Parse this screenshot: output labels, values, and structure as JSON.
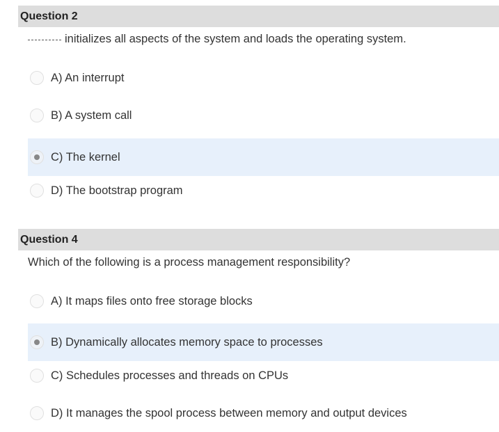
{
  "questions": [
    {
      "title": "Question 2",
      "blank": "______",
      "prompt": "initializes all aspects of the system and loads the operating system.",
      "options": [
        {
          "label": "A) An interrupt",
          "selected": false
        },
        {
          "label": "B) A system call",
          "selected": false
        },
        {
          "label": "C) The kernel",
          "selected": true
        },
        {
          "label": "D) The bootstrap program",
          "selected": false
        }
      ]
    },
    {
      "title": "Question 4",
      "prompt": "Which of the following is a process management responsibility?",
      "options": [
        {
          "label": "A) It maps files onto free storage blocks",
          "selected": false
        },
        {
          "label": "B) Dynamically allocates memory space to processes",
          "selected": true
        },
        {
          "label": "C) Schedules processes and threads on CPUs",
          "selected": false
        },
        {
          "label": "D) It manages the spool process between memory and output devices",
          "selected": false
        }
      ]
    }
  ]
}
